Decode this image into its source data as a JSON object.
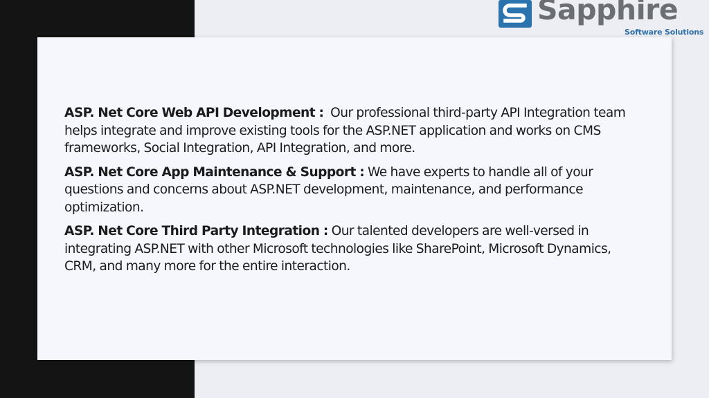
{
  "brand": {
    "name": "Sapphire",
    "tagline": "Software Solutions",
    "colors": {
      "dark_panel": "#141414",
      "logo_text": "#6b6e73",
      "logo_accent": "#2f6fa8"
    }
  },
  "sections": [
    {
      "heading": "ASP. Net Core Web API Development :",
      "body": "Our professional third-party API Integration team helps integrate and improve existing tools for the ASP.NET application and works on CMS frameworks, Social Integration, API Integration, and more."
    },
    {
      "heading": "ASP. Net Core App Maintenance & Support :",
      "body": "We have experts to handle all of your questions and concerns about ASP.NET development, maintenance, and performance optimization."
    },
    {
      "heading": "ASP. Net Core Third Party Integration :",
      "body": "Our talented developers are well-versed in integrating ASP.NET with other Microsoft technologies like SharePoint, Microsoft Dynamics, CRM, and many more for the entire interaction."
    }
  ]
}
